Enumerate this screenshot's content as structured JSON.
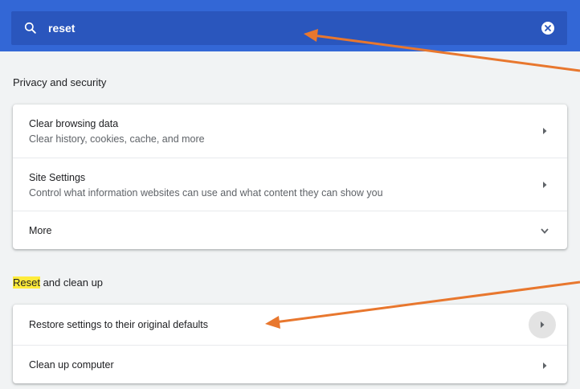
{
  "search": {
    "value": "reset",
    "icon": "search-icon",
    "clear_icon": "close-icon"
  },
  "sections": [
    {
      "title": "Privacy and security",
      "items": [
        {
          "title": "Clear browsing data",
          "subtitle": "Clear history, cookies, cache, and more",
          "icon": "chevron-right-icon"
        },
        {
          "title": "Site Settings",
          "subtitle": "Control what information websites can use and what content they can show you",
          "icon": "chevron-right-icon"
        },
        {
          "title": "More",
          "icon": "chevron-down-icon"
        }
      ]
    },
    {
      "title_highlight": "Reset",
      "title_rest": " and clean up",
      "items": [
        {
          "title": "Restore settings to their original defaults",
          "icon": "chevron-right-icon"
        },
        {
          "title": "Clean up computer",
          "icon": "chevron-right-icon"
        }
      ]
    }
  ],
  "colors": {
    "header": "#3367d6",
    "search_bar": "#2a56bd",
    "background": "#f1f3f4",
    "highlight": "#ffeb3b",
    "annotation_arrow": "#e8772e"
  }
}
